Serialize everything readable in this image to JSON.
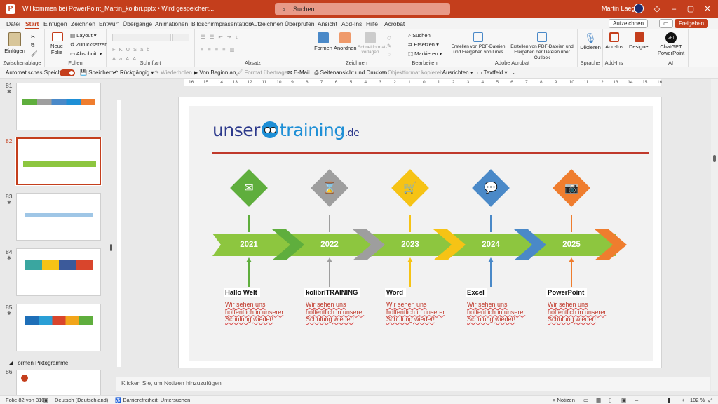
{
  "window": {
    "doc_title": "Willkommen bei PowerPoint_Martin_kolibri.pptx • Wird gespeichert...",
    "search_placeholder": "Suchen",
    "user": "Martin Laegel"
  },
  "tabs": [
    "Datei",
    "Start",
    "Einfügen",
    "Zeichnen",
    "Entwurf",
    "Übergänge",
    "Animationen",
    "Bildschirmpräsentation",
    "Aufzeichnen",
    "Überprüfen",
    "Ansicht",
    "Add-Ins",
    "Hilfe",
    "Acrobat"
  ],
  "tab_buttons": {
    "record": "Aufzeichnen",
    "share": "Freigeben"
  },
  "ribbon": {
    "clipboard": {
      "paste": "Einfügen",
      "label": "Zwischenablage"
    },
    "slides": {
      "new_slide": "Neue Folie",
      "layout": "Layout",
      "reset": "Zurücksetzen",
      "section": "Abschnitt",
      "label": "Folien"
    },
    "font": {
      "label": "Schriftart"
    },
    "paragraph": {
      "label": "Absatz"
    },
    "drawing": {
      "shapes": "Formen",
      "arrange": "Anordnen",
      "quick_styles": "Schnellformat-vorlagen",
      "label": "Zeichnen"
    },
    "editing": {
      "find": "Suchen",
      "replace": "Ersetzen",
      "select": "Markieren",
      "label": "Bearbeiten"
    },
    "acrobat": {
      "create_share": "Erstellen von PDF-Dateien und Freigeben von Links",
      "create_outlook": "Erstellen von PDF-Dateien und Freigeben der Dateien über Outlook",
      "label": "Adobe Acrobat"
    },
    "voice": {
      "dictate": "Diktieren",
      "label": "Sprache"
    },
    "addins": {
      "addins": "Add-Ins",
      "label": "Add-Ins"
    },
    "designer": {
      "designer": "Designer"
    },
    "ai": {
      "chatgpt": "ChatGPT PowerPoint",
      "badge": "GPT",
      "label": "AI"
    }
  },
  "quick_access": {
    "autosave": "Automatisches Speichern",
    "save": "Speichern",
    "undo": "Rückgängig",
    "redo": "Wiederholen",
    "from_start": "Von Beginn an",
    "format_painter": "Format übertragen",
    "email": "E-Mail",
    "print_preview": "Seitenansicht und Drucken",
    "copy_format": "Objektformat kopieren",
    "align": "Ausrichten",
    "textbox": "Textfeld"
  },
  "thumbnails": [
    {
      "num": "81",
      "star": "✱",
      "title": ""
    },
    {
      "num": "82",
      "star": "",
      "title": ""
    },
    {
      "num": "83",
      "star": "✱",
      "title": ""
    },
    {
      "num": "84",
      "star": "✱",
      "title": ""
    },
    {
      "num": "85",
      "star": "✱",
      "title": ""
    }
  ],
  "section_name": "Formen Piktogramme",
  "next_thumb_num": "86",
  "ruler_ticks": [
    "16",
    "15",
    "14",
    "13",
    "12",
    "11",
    "10",
    "9",
    "8",
    "7",
    "6",
    "5",
    "4",
    "3",
    "2",
    "1",
    "0",
    "1",
    "2",
    "3",
    "4",
    "5",
    "6",
    "7",
    "8",
    "9",
    "10",
    "11",
    "12",
    "13",
    "14",
    "15",
    "16"
  ],
  "slide": {
    "logo_left": "unser",
    "logo_right": "training",
    "logo_tld": ".de",
    "milestones": [
      {
        "year": "2021",
        "title": "Hallo Welt",
        "text": "Wir sehen uns hoffentlich in unserer Schulung wieder!",
        "color": "#5fae3d",
        "icon": "✉"
      },
      {
        "year": "2022",
        "title": "kolibriTRAINING",
        "text": "Wir sehen uns hoffentlich in unserer Schulung wieder!",
        "color": "#9e9e9e",
        "icon": "⌛"
      },
      {
        "year": "2023",
        "title": "Word",
        "text": "Wir sehen uns hoffentlich in unserer Schulung wieder!",
        "color": "#f6c315",
        "icon": "🛒"
      },
      {
        "year": "2024",
        "title": "Excel",
        "text": "Wir sehen uns hoffentlich in unserer Schulung wieder!",
        "color": "#4a89c8",
        "icon": "💬"
      },
      {
        "year": "2025",
        "title": "PowerPoint",
        "text": "Wir sehen uns hoffentlich in unserer Schulung wieder!",
        "color": "#ef7d2e",
        "icon": "📷"
      }
    ],
    "band_color": "#8dc63f"
  },
  "notes_placeholder": "Klicken Sie, um Notizen hinzuzufügen",
  "status": {
    "slide_info": "Folie 82 von 310",
    "language": "Deutsch (Deutschland)",
    "accessibility": "Barrierefreiheit: Untersuchen",
    "notes": "Notizen",
    "zoom": "102 %"
  }
}
